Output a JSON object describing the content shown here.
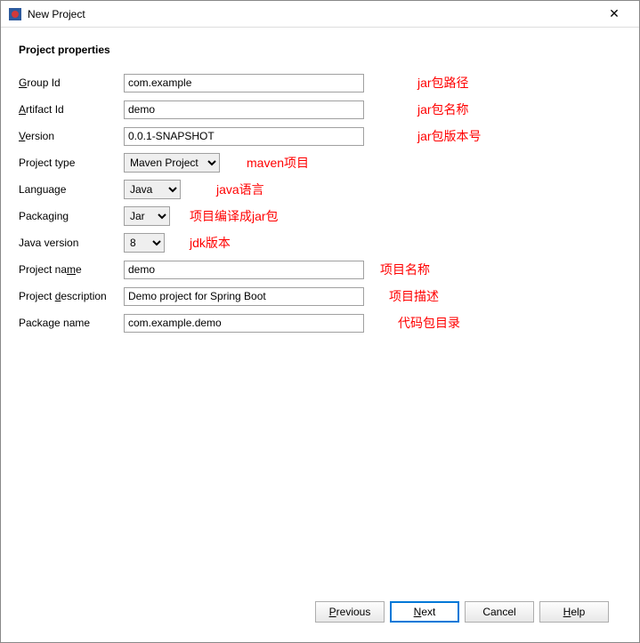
{
  "window": {
    "title": "New Project"
  },
  "section_title": "Project properties",
  "fields": {
    "group_id": {
      "label_pre": "",
      "label_u": "G",
      "label_post": "roup Id",
      "value": "com.example",
      "annot": "jar包路径"
    },
    "artifact_id": {
      "label_pre": "",
      "label_u": "A",
      "label_post": "rtifact Id",
      "value": "demo",
      "annot": "jar包名称"
    },
    "version": {
      "label_pre": "",
      "label_u": "V",
      "label_post": "ersion",
      "value": "0.0.1-SNAPSHOT",
      "annot": "jar包版本号"
    },
    "project_type": {
      "label": "Project type",
      "value": "Maven Project",
      "annot": "maven项目"
    },
    "language": {
      "label": "Language",
      "value": "Java",
      "annot": "java语言"
    },
    "packaging": {
      "label": "Packaging",
      "value": "Jar",
      "annot": "项目编译成jar包"
    },
    "java_version": {
      "label": "Java version",
      "value": "8",
      "annot": "jdk版本"
    },
    "project_name": {
      "label_pre": "Project na",
      "label_u": "m",
      "label_post": "e",
      "value": "demo",
      "annot": "项目名称"
    },
    "project_description": {
      "label_pre": "Project ",
      "label_u": "d",
      "label_post": "escription",
      "value": "Demo project for Spring Boot",
      "annot": "项目描述"
    },
    "package_name": {
      "label_pre": "Packa",
      "label_u": "g",
      "label_post": "e name",
      "value": "com.example.demo",
      "annot": "代码包目录"
    }
  },
  "buttons": {
    "previous": {
      "pre": "",
      "u": "P",
      "post": "revious"
    },
    "next": {
      "pre": "",
      "u": "N",
      "post": "ext"
    },
    "cancel": {
      "text": "Cancel"
    },
    "help": {
      "pre": "",
      "u": "H",
      "post": "elp"
    }
  }
}
